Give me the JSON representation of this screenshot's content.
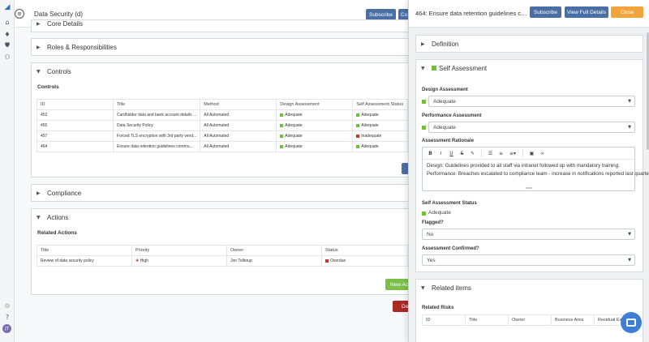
{
  "main": {
    "page_title": "Data Security (d)",
    "subscribe_label": "Subscribe",
    "cut_button_label": "Co",
    "sections": {
      "core_details": "Core Details",
      "roles": "Roles & Responsibilities",
      "controls": "Controls",
      "compliance": "Compliance",
      "actions": "Actions"
    },
    "controls": {
      "subheading": "Controls",
      "columns": [
        "ID",
        "Title",
        "Method",
        "Design Assessment",
        "Self Assessment Status"
      ],
      "rows": [
        {
          "id": "452",
          "title": "Cardholder data and bank account details ...",
          "method": "All Automated",
          "design": "Adequate",
          "self": "Adequate",
          "self_color": "g"
        },
        {
          "id": "455",
          "title": "Data Security Policy",
          "method": "All Automated",
          "design": "Adequate",
          "self": "Adequate",
          "self_color": "g"
        },
        {
          "id": "457",
          "title": "Forced TLS encryption with 3rd party vend...",
          "method": "All Automated",
          "design": "Adequate",
          "self": "Inadequate",
          "self_color": "r"
        },
        {
          "id": "464",
          "title": "Ensure data retention guidelines commu...",
          "method": "All Automated",
          "design": "Adequate",
          "self": "Adequate",
          "self_color": "g"
        }
      ]
    },
    "actions": {
      "subheading": "Related Actions",
      "columns": [
        "Title",
        "Priority",
        "Owner",
        "Status"
      ],
      "rows": [
        {
          "title": "Review of data security policy",
          "priority": "High",
          "owner": "Jon Tollerup",
          "status": "Overdue"
        }
      ],
      "new_action_label": "New Acti",
      "delete_label": "De"
    }
  },
  "drawer": {
    "title": "464: Ensure data retention guidelines co...",
    "subscribe_label": "Subscribe",
    "view_details_label": "View Full Details",
    "close_label": "Close",
    "definition_label": "Definition",
    "self_assessment_label": "Self Assessment",
    "design_assessment_label": "Design Assessment",
    "design_assessment_value": "Adequate",
    "performance_assessment_label": "Performance Assessment",
    "performance_assessment_value": "Adequate",
    "rationale_label": "Assessment Rationale",
    "rationale_line1": "Design: Guidelines provided to all staff via intranet followed up with mandatory training.",
    "rationale_line2": "Performance:  Breaches escalated to compliance team - increase in notifications reported last quarter.",
    "status_label": "Self Assessment Status",
    "status_value": "Adequate",
    "flagged_label": "Flagged?",
    "flagged_value": "No",
    "confirmed_label": "Assessment Confirmed?",
    "confirmed_value": "Yes",
    "related_items_label": "Related items",
    "related_risks_label": "Related Risks",
    "risk_columns": [
      "ID",
      "Title",
      "Owner",
      "Business Area",
      "Residual Expos"
    ]
  },
  "rail": {
    "avatar_initials": "JT"
  },
  "colors": {
    "primary": "#4a6fa5",
    "success": "#7bbf4a",
    "warning": "#f0a43a",
    "danger": "#a92a25",
    "adequate": "#6fbf3a",
    "inadequate": "#c0392b"
  }
}
